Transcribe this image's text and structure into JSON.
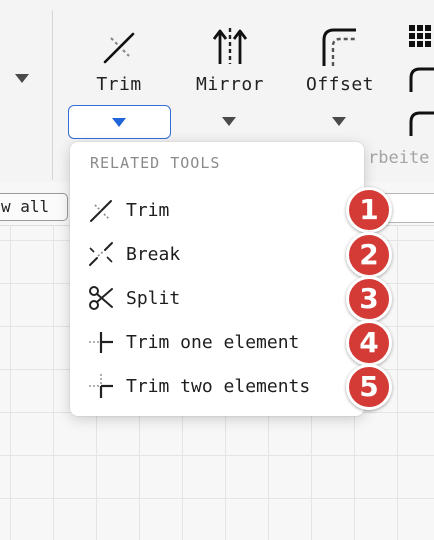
{
  "ribbon": {
    "tools": [
      {
        "label": "Trim",
        "icon": "trim-icon"
      },
      {
        "label": "Mirror",
        "icon": "mirror-icon"
      },
      {
        "label": "Offset",
        "icon": "offset-icon"
      }
    ],
    "partial_label": "rbeite",
    "view_all_label": "w all"
  },
  "menu": {
    "header": "RELATED TOOLS",
    "items": [
      {
        "label": "Trim",
        "icon": "trim-icon",
        "badge": "1"
      },
      {
        "label": "Break",
        "icon": "break-icon",
        "badge": "2"
      },
      {
        "label": "Split",
        "icon": "scissors-icon",
        "badge": "3"
      },
      {
        "label": "Trim one element",
        "icon": "trim-one-element-icon",
        "badge": "4"
      },
      {
        "label": "Trim two elements",
        "icon": "trim-two-elements-icon",
        "badge": "5"
      }
    ]
  },
  "colors": {
    "accent": "#2f6fd6",
    "badge": "#d43a36",
    "muted_text": "#8a8a8a"
  }
}
